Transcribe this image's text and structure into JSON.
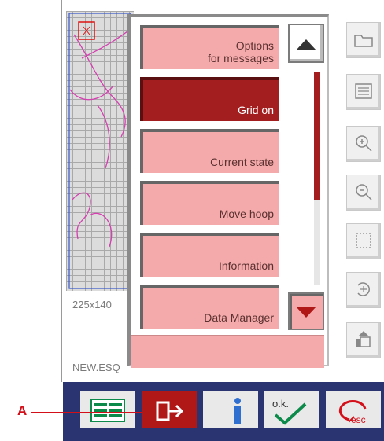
{
  "canvas": {
    "size_label": "225x140",
    "file_label": "NEW.ESQ"
  },
  "menu": {
    "items": [
      {
        "label_line1": "Options",
        "label_line2": "for messages",
        "state": "normal"
      },
      {
        "label_line1": "",
        "label_line2": "Grid on",
        "state": "active"
      },
      {
        "label_line1": "",
        "label_line2": "Current state",
        "state": "normal"
      },
      {
        "label_line1": "",
        "label_line2": "Move hoop",
        "state": "normal"
      },
      {
        "label_line1": "",
        "label_line2": "Information",
        "state": "normal"
      },
      {
        "label_line1": "",
        "label_line2": "Data Manager",
        "state": "normal"
      }
    ],
    "scroll": {
      "position_fraction": 0.0,
      "visible_fraction": 0.6
    }
  },
  "side_tools": [
    "folder-icon",
    "list-icon",
    "zoom-in-icon",
    "zoom-out-icon",
    "select-icon",
    "rotate-icon",
    "hoop-icon"
  ],
  "bottom_bar": {
    "buttons": [
      {
        "icon": "menu-list-icon"
      },
      {
        "icon": "exit-icon",
        "active": true
      },
      {
        "icon": "info-icon"
      },
      {
        "icon": "ok-check-icon",
        "label": "o.k."
      },
      {
        "icon": "esc-icon",
        "label": "esc"
      }
    ]
  },
  "callout": {
    "letter": "A"
  },
  "colors": {
    "menu_button": "#f4aaaa",
    "menu_active": "#a31f1f",
    "bottom_bar": "#2a3470",
    "accent_green": "#0b8a4a",
    "callout_red": "#d3101a"
  }
}
